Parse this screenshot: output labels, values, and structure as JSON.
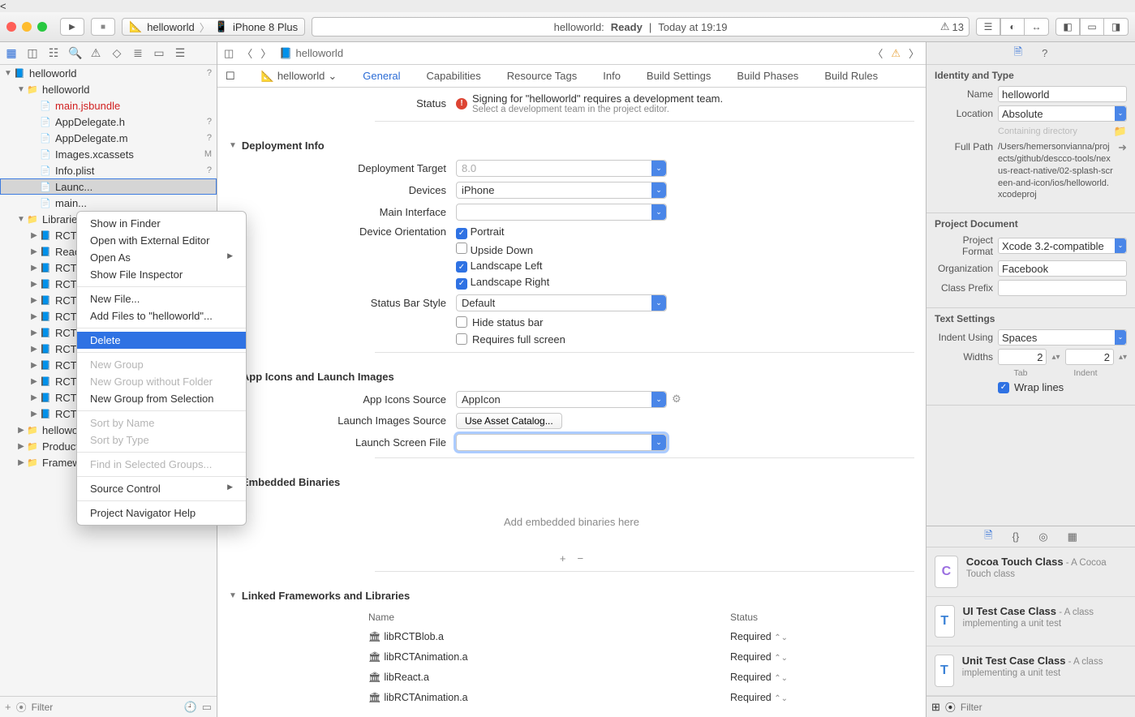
{
  "titlebar": {
    "scheme_app": "helloworld",
    "scheme_device": "iPhone 8 Plus",
    "status_app": "helloworld:",
    "status_state": "Ready",
    "status_sep": "|",
    "status_time": "Today at 19:19",
    "warning_count": "13"
  },
  "navigator": {
    "root": "helloworld",
    "group": "helloworld",
    "files": [
      {
        "name": "main.jsbundle",
        "badge": "",
        "red": true
      },
      {
        "name": "AppDelegate.h",
        "badge": "?"
      },
      {
        "name": "AppDelegate.m",
        "badge": "?"
      },
      {
        "name": "Images.xcassets",
        "badge": "M"
      },
      {
        "name": "Info.plist",
        "badge": "?"
      },
      {
        "name": "Launc...",
        "badge": ""
      },
      {
        "name": "main...",
        "badge": ""
      }
    ],
    "libraries_label": "Libraries",
    "libs": [
      "RCTA",
      "React",
      "RCTA",
      "RCTB",
      "RCTG",
      "RCTIr",
      "RCTL",
      "RCTN",
      "RCTS",
      "RCTT",
      "RCTV",
      "RCTV"
    ],
    "folders": [
      {
        "name": "helloworld"
      },
      {
        "name": "Products"
      },
      {
        "name": "Framew..."
      }
    ],
    "filter_placeholder": "Filter"
  },
  "context_menu": {
    "items": [
      {
        "t": "Show in Finder"
      },
      {
        "t": "Open with External Editor"
      },
      {
        "t": "Open As",
        "arrow": true
      },
      {
        "t": "Show File Inspector"
      },
      {
        "sep": true
      },
      {
        "t": "New File..."
      },
      {
        "t": "Add Files to \"helloworld\"..."
      },
      {
        "sep": true
      },
      {
        "t": "Delete",
        "hov": true
      },
      {
        "sep": true
      },
      {
        "t": "New Group",
        "disabled": true
      },
      {
        "t": "New Group without Folder",
        "disabled": true
      },
      {
        "t": "New Group from Selection"
      },
      {
        "sep": true
      },
      {
        "t": "Sort by Name",
        "disabled": true
      },
      {
        "t": "Sort by Type",
        "disabled": true
      },
      {
        "sep": true
      },
      {
        "t": "Find in Selected Groups...",
        "disabled": true
      },
      {
        "sep": true
      },
      {
        "t": "Source Control",
        "arrow": true
      },
      {
        "sep": true
      },
      {
        "t": "Project Navigator Help"
      }
    ]
  },
  "editor": {
    "jump_bar_item": "helloworld",
    "target": "helloworld",
    "tabs": [
      "General",
      "Capabilities",
      "Resource Tags",
      "Info",
      "Build Settings",
      "Build Phases",
      "Build Rules"
    ],
    "signing": {
      "label": "Status",
      "error": "Signing for \"helloworld\" requires a development team.",
      "hint": "Select a development team in the project editor."
    },
    "deployment": {
      "heading": "Deployment Info",
      "target_label": "Deployment Target",
      "target_value": "8.0",
      "devices_label": "Devices",
      "devices_value": "iPhone",
      "main_interface_label": "Main Interface",
      "main_interface_value": "",
      "orientation_label": "Device Orientation",
      "orientations": [
        {
          "t": "Portrait",
          "c": true
        },
        {
          "t": "Upside Down",
          "c": false
        },
        {
          "t": "Landscape Left",
          "c": true
        },
        {
          "t": "Landscape Right",
          "c": true
        }
      ],
      "statusbar_label": "Status Bar Style",
      "statusbar_value": "Default",
      "hide_sb": "Hide status bar",
      "req_fs": "Requires full screen"
    },
    "icons": {
      "heading": "App Icons and Launch Images",
      "source_label": "App Icons Source",
      "source_value": "AppIcon",
      "launch_images_label": "Launch Images Source",
      "launch_images_btn": "Use Asset Catalog...",
      "launch_screen_label": "Launch Screen File",
      "launch_screen_value": ""
    },
    "embedded": {
      "heading": "Embedded Binaries",
      "placeholder": "Add embedded binaries here"
    },
    "linked": {
      "heading": "Linked Frameworks and Libraries",
      "col_name": "Name",
      "col_status": "Status",
      "rows": [
        {
          "n": "libRCTBlob.a",
          "s": "Required"
        },
        {
          "n": "libRCTAnimation.a",
          "s": "Required"
        },
        {
          "n": "libReact.a",
          "s": "Required"
        },
        {
          "n": "libRCTAnimation.a",
          "s": "Required"
        }
      ]
    }
  },
  "inspector": {
    "identity": {
      "heading": "Identity and Type",
      "name_label": "Name",
      "name_value": "helloworld",
      "location_label": "Location",
      "location_value": "Absolute",
      "containing": "Containing directory",
      "fullpath_label": "Full Path",
      "fullpath_value": "/Users/hemersonvianna/projects/github/descco-tools/nexus-react-native/02-splash-screen-and-icon/ios/helloworld.xcodeproj"
    },
    "project_doc": {
      "heading": "Project Document",
      "format_label": "Project Format",
      "format_value": "Xcode 3.2-compatible",
      "org_label": "Organization",
      "org_value": "Facebook",
      "prefix_label": "Class Prefix",
      "prefix_value": ""
    },
    "text": {
      "heading": "Text Settings",
      "indent_label": "Indent Using",
      "indent_value": "Spaces",
      "widths_label": "Widths",
      "tab_value": "2",
      "indent_width": "2",
      "tab_sub": "Tab",
      "indent_sub": "Indent",
      "wrap": "Wrap lines"
    },
    "library": {
      "items": [
        {
          "glyph": "C",
          "cls": "c",
          "title": "Cocoa Touch Class",
          "desc": " - A Cocoa Touch class"
        },
        {
          "glyph": "T",
          "cls": "t",
          "title": "UI Test Case Class",
          "desc": " - A class implementing a unit test"
        },
        {
          "glyph": "T",
          "cls": "t",
          "title": "Unit Test Case Class",
          "desc": " - A class implementing a unit test"
        }
      ],
      "filter_placeholder": "Filter"
    }
  }
}
